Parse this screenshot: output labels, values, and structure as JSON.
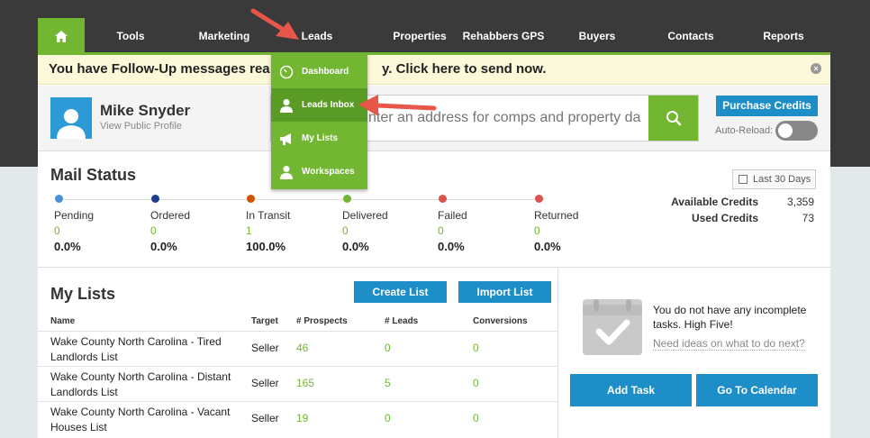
{
  "nav": {
    "home_icon": "home-icon",
    "items": [
      "Tools",
      "Marketing",
      "Leads",
      "Properties",
      "Rehabbers GPS",
      "Buyers",
      "Contacts",
      "Reports"
    ]
  },
  "notice": {
    "text_before": "You have Follow-Up messages rea",
    "text_after": "y. Click here to send now."
  },
  "profile": {
    "name": "Mike Snyder",
    "link": "View Public Profile"
  },
  "search": {
    "placeholder": "nter an address for comps and property da"
  },
  "purchase": {
    "label": "Purchase Credits",
    "auto_reload": "Auto-Reload:"
  },
  "mail": {
    "title": "Mail Status",
    "date_range": "Last 30 Days",
    "statuses": [
      {
        "label": "Pending",
        "count": "0",
        "pct": "0.0%",
        "color": "#4a90d9"
      },
      {
        "label": "Ordered",
        "count": "0",
        "pct": "0.0%",
        "color": "#1d3c8a"
      },
      {
        "label": "In Transit",
        "count": "1",
        "pct": "100.0%",
        "color": "#d35400"
      },
      {
        "label": "Delivered",
        "count": "0",
        "pct": "0.0%",
        "color": "#72b632"
      },
      {
        "label": "Failed",
        "count": "0",
        "pct": "0.0%",
        "color": "#d9534f"
      },
      {
        "label": "Returned",
        "count": "0",
        "pct": "0.0%",
        "color": "#d9534f"
      }
    ],
    "credits": [
      {
        "label": "Available Credits",
        "value": "3,359"
      },
      {
        "label": "Used Credits",
        "value": "73"
      }
    ]
  },
  "lists": {
    "title": "My Lists",
    "create": "Create List",
    "import": "Import List",
    "headers": [
      "Name",
      "Target",
      "# Prospects",
      "# Leads",
      "Conversions"
    ],
    "rows": [
      {
        "name": "Wake County North Carolina - Tired Landlords List",
        "target": "Seller",
        "prospects": "46",
        "leads": "0",
        "conversions": "0"
      },
      {
        "name": "Wake County North Carolina - Distant Landlords List",
        "target": "Seller",
        "prospects": "165",
        "leads": "5",
        "conversions": "0"
      },
      {
        "name": "Wake County North Carolina - Vacant Houses List",
        "target": "Seller",
        "prospects": "19",
        "leads": "0",
        "conversions": "0"
      }
    ]
  },
  "tasks": {
    "message": "You do not have any incomplete tasks. High Five!",
    "link": "Need ideas on what to do next?",
    "add": "Add Task",
    "calendar": "Go To Calendar"
  },
  "dropdown": {
    "items": [
      {
        "label": "Dashboard",
        "icon": "dashboard-icon"
      },
      {
        "label": "Leads Inbox",
        "icon": "person-icon"
      },
      {
        "label": "My Lists",
        "icon": "megaphone-icon"
      },
      {
        "label": "Workspaces",
        "icon": "person-icon"
      }
    ]
  },
  "colors": {
    "brand_green": "#72b632",
    "button_blue": "#1e8ec8",
    "arrow_red": "#e8564a"
  }
}
